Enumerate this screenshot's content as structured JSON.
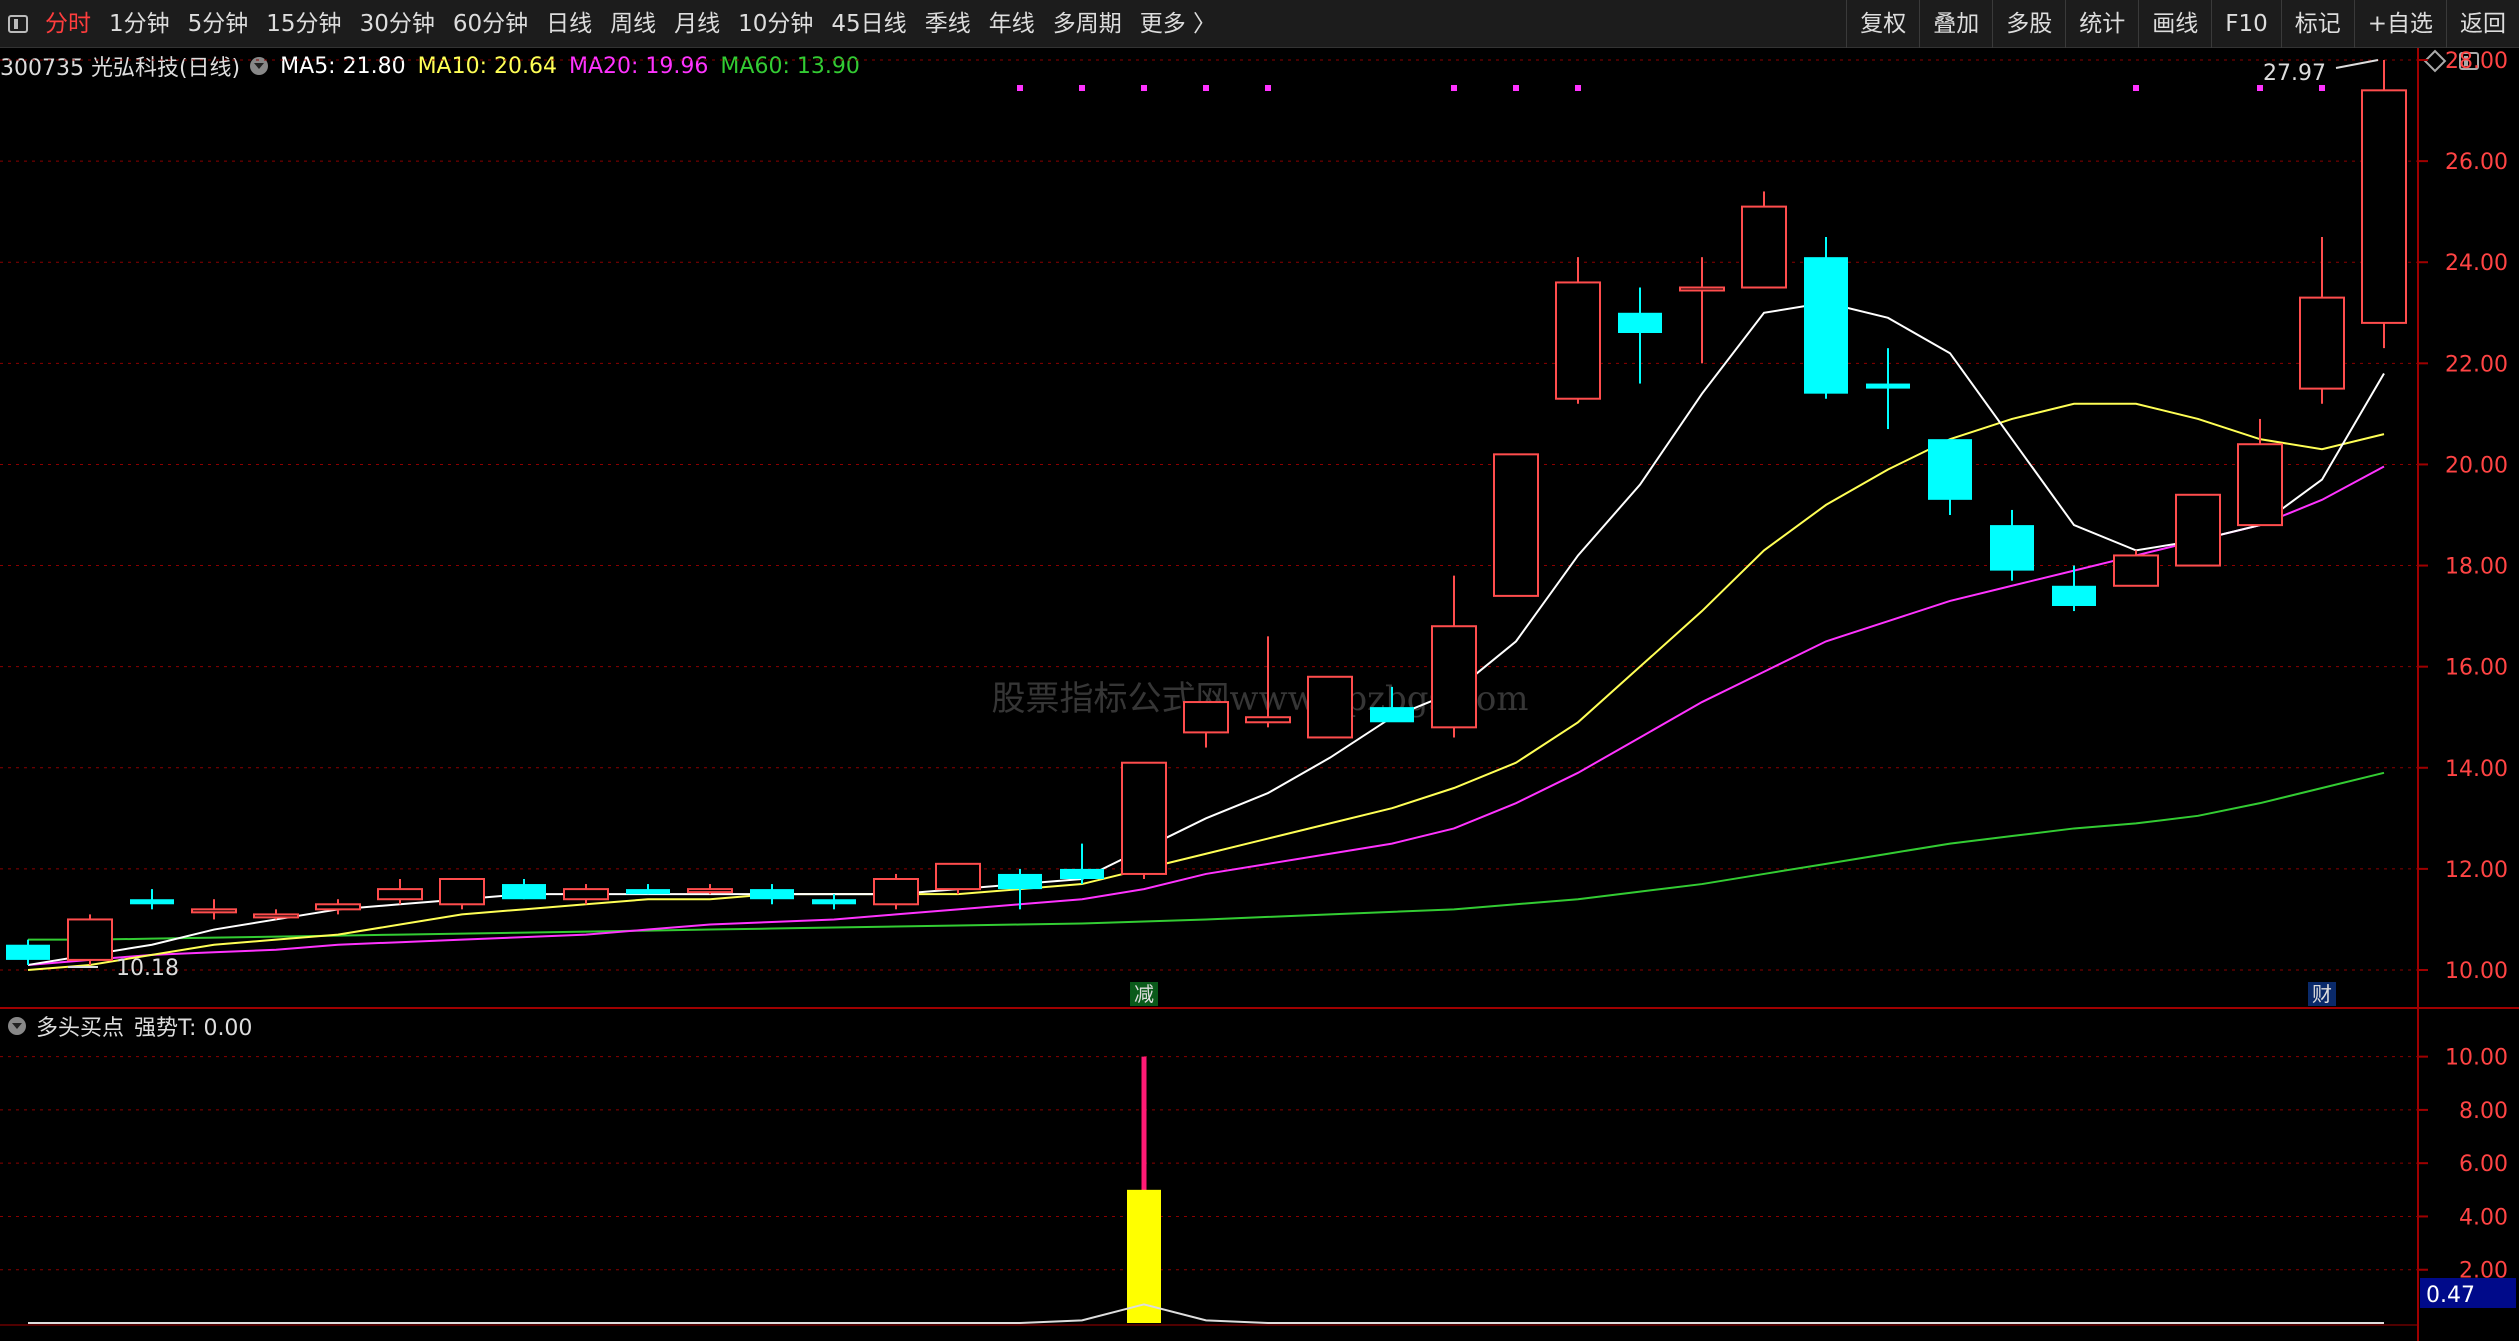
{
  "toolbar": {
    "periods": [
      "分时",
      "1分钟",
      "5分钟",
      "15分钟",
      "30分钟",
      "60分钟",
      "日线",
      "周线",
      "月线",
      "10分钟",
      "45日线",
      "季线",
      "年线",
      "多周期",
      "更多 〉"
    ],
    "active_period": "分时",
    "tools": [
      "复权",
      "叠加",
      "多股",
      "统计",
      "画线",
      "F10",
      "标记",
      "+自选",
      "返回"
    ]
  },
  "stock": {
    "code_name": "300735 光弘科技(日线)",
    "ma5": "MA5: 21.80",
    "ma10": "MA10: 20.64",
    "ma20": "MA20: 19.96",
    "ma60": "MA60: 13.90"
  },
  "indicator": {
    "title": "多头买点",
    "value": "强势T: 0.00"
  },
  "watermark": "股票指标公式网www.gpzbgs.com",
  "colors": {
    "up": "#ff4d4d",
    "down": "#00ffff",
    "ma5": "#ffffff",
    "ma10": "#ffff55",
    "ma20": "#ff33ff",
    "ma60": "#33cc33",
    "grid": "#8b0000"
  },
  "chart_data": {
    "type": "candlestick",
    "y_axis": {
      "min": 10,
      "max": 28,
      "ticks": [
        "10.00",
        "12.00",
        "14.00",
        "16.00",
        "18.00",
        "20.00",
        "22.00",
        "24.00",
        "26.00",
        "28.00"
      ]
    },
    "candles": [
      {
        "o": 10.5,
        "h": 10.6,
        "l": 10.1,
        "c": 10.2
      },
      {
        "o": 10.2,
        "h": 11.1,
        "l": 10.1,
        "c": 11.0
      },
      {
        "o": 11.4,
        "h": 11.6,
        "l": 11.2,
        "c": 11.3
      },
      {
        "o": 11.2,
        "h": 11.4,
        "l": 11.0,
        "c": 11.2
      },
      {
        "o": 11.1,
        "h": 11.2,
        "l": 11.0,
        "c": 11.1
      },
      {
        "o": 11.2,
        "h": 11.4,
        "l": 11.1,
        "c": 11.3
      },
      {
        "o": 11.4,
        "h": 11.8,
        "l": 11.3,
        "c": 11.6
      },
      {
        "o": 11.3,
        "h": 11.8,
        "l": 11.2,
        "c": 11.8
      },
      {
        "o": 11.7,
        "h": 11.8,
        "l": 11.4,
        "c": 11.4
      },
      {
        "o": 11.4,
        "h": 11.7,
        "l": 11.3,
        "c": 11.6
      },
      {
        "o": 11.6,
        "h": 11.7,
        "l": 11.5,
        "c": 11.5
      },
      {
        "o": 11.6,
        "h": 11.7,
        "l": 11.5,
        "c": 11.6
      },
      {
        "o": 11.6,
        "h": 11.7,
        "l": 11.3,
        "c": 11.4
      },
      {
        "o": 11.4,
        "h": 11.5,
        "l": 11.2,
        "c": 11.3
      },
      {
        "o": 11.3,
        "h": 11.9,
        "l": 11.2,
        "c": 11.8
      },
      {
        "o": 11.6,
        "h": 12.1,
        "l": 11.5,
        "c": 12.1
      },
      {
        "o": 11.9,
        "h": 12.0,
        "l": 11.2,
        "c": 11.6
      },
      {
        "o": 12.0,
        "h": 12.5,
        "l": 11.7,
        "c": 11.8
      },
      {
        "o": 11.9,
        "h": 14.1,
        "l": 11.8,
        "c": 14.1
      },
      {
        "o": 14.7,
        "h": 15.3,
        "l": 14.4,
        "c": 15.3
      },
      {
        "o": 14.9,
        "h": 16.6,
        "l": 14.8,
        "c": 15.0
      },
      {
        "o": 14.6,
        "h": 15.8,
        "l": 14.6,
        "c": 15.8
      },
      {
        "o": 15.2,
        "h": 15.6,
        "l": 15.0,
        "c": 14.9
      },
      {
        "o": 14.8,
        "h": 17.8,
        "l": 14.6,
        "c": 16.8
      },
      {
        "o": 17.4,
        "h": 20.2,
        "l": 17.4,
        "c": 20.2
      },
      {
        "o": 21.3,
        "h": 24.1,
        "l": 21.2,
        "c": 23.6
      },
      {
        "o": 23.0,
        "h": 23.5,
        "l": 21.6,
        "c": 22.6
      },
      {
        "o": 23.5,
        "h": 24.1,
        "l": 22.0,
        "c": 23.5
      },
      {
        "o": 23.5,
        "h": 25.4,
        "l": 23.5,
        "c": 25.1
      },
      {
        "o": 24.1,
        "h": 24.5,
        "l": 21.3,
        "c": 21.4
      },
      {
        "o": 21.6,
        "h": 22.3,
        "l": 20.7,
        "c": 21.5
      },
      {
        "o": 20.5,
        "h": 20.5,
        "l": 19.0,
        "c": 19.3
      },
      {
        "o": 18.8,
        "h": 19.1,
        "l": 17.7,
        "c": 17.9
      },
      {
        "o": 17.6,
        "h": 18.0,
        "l": 17.1,
        "c": 17.2
      },
      {
        "o": 17.6,
        "h": 18.3,
        "l": 17.6,
        "c": 18.2
      },
      {
        "o": 18.0,
        "h": 19.4,
        "l": 18.0,
        "c": 19.4
      },
      {
        "o": 18.8,
        "h": 20.9,
        "l": 18.8,
        "c": 20.4
      },
      {
        "o": 21.5,
        "h": 24.5,
        "l": 21.2,
        "c": 23.3
      },
      {
        "o": 22.8,
        "h": 28.0,
        "l": 22.3,
        "c": 27.4
      }
    ],
    "ma5": [
      10.1,
      10.3,
      10.5,
      10.8,
      11.0,
      11.2,
      11.3,
      11.4,
      11.5,
      11.5,
      11.5,
      11.5,
      11.5,
      11.5,
      11.5,
      11.6,
      11.7,
      11.8,
      12.4,
      13.0,
      13.5,
      14.2,
      15.0,
      15.5,
      16.5,
      18.2,
      19.6,
      21.4,
      23.0,
      23.2,
      22.9,
      22.2,
      20.5,
      18.8,
      18.3,
      18.5,
      18.8,
      19.7,
      21.8
    ],
    "ma10": [
      10.0,
      10.1,
      10.3,
      10.5,
      10.6,
      10.7,
      10.9,
      11.1,
      11.2,
      11.3,
      11.4,
      11.4,
      11.5,
      11.5,
      11.5,
      11.5,
      11.6,
      11.7,
      12.0,
      12.3,
      12.6,
      12.9,
      13.2,
      13.6,
      14.1,
      14.9,
      16.0,
      17.1,
      18.3,
      19.2,
      19.9,
      20.5,
      20.9,
      21.2,
      21.2,
      20.9,
      20.5,
      20.3,
      20.6
    ],
    "ma20": [
      10.1,
      10.2,
      10.3,
      10.35,
      10.4,
      10.5,
      10.55,
      10.6,
      10.65,
      10.7,
      10.8,
      10.9,
      10.95,
      11.0,
      11.1,
      11.2,
      11.3,
      11.4,
      11.6,
      11.9,
      12.1,
      12.3,
      12.5,
      12.8,
      13.3,
      13.9,
      14.6,
      15.3,
      15.9,
      16.5,
      16.9,
      17.3,
      17.6,
      17.9,
      18.2,
      18.5,
      18.8,
      19.3,
      19.96
    ],
    "ma60": [
      10.6,
      10.6,
      10.62,
      10.64,
      10.66,
      10.68,
      10.7,
      10.72,
      10.74,
      10.76,
      10.78,
      10.8,
      10.82,
      10.84,
      10.86,
      10.88,
      10.9,
      10.92,
      10.96,
      11.0,
      11.05,
      11.1,
      11.15,
      11.2,
      11.3,
      11.4,
      11.55,
      11.7,
      11.9,
      12.1,
      12.3,
      12.5,
      12.65,
      12.8,
      12.9,
      13.05,
      13.3,
      13.6,
      13.9
    ],
    "high_marker": "27.97",
    "low_marker": "10.18",
    "event_markers": [
      {
        "index": 18,
        "label": "减"
      },
      {
        "index": 37,
        "label": "财"
      }
    ],
    "top_dot_indices": [
      16,
      17,
      18,
      19,
      20,
      23,
      24,
      25,
      34,
      36,
      37
    ],
    "indicator_panel": {
      "y_ticks": [
        "2.00",
        "4.00",
        "6.00",
        "8.00",
        "10.00"
      ],
      "current_value": "0.47",
      "bar_index": 18,
      "bar_value": 5.0,
      "line_value": 10.0,
      "curve": [
        0,
        0,
        0,
        0,
        0,
        0,
        0,
        0,
        0,
        0,
        0,
        0,
        0,
        0,
        0,
        0,
        0,
        0.1,
        0.7,
        0.1,
        0,
        0,
        0,
        0,
        0,
        0,
        0,
        0,
        0,
        0,
        0,
        0,
        0,
        0,
        0,
        0,
        0,
        0,
        0
      ]
    }
  }
}
